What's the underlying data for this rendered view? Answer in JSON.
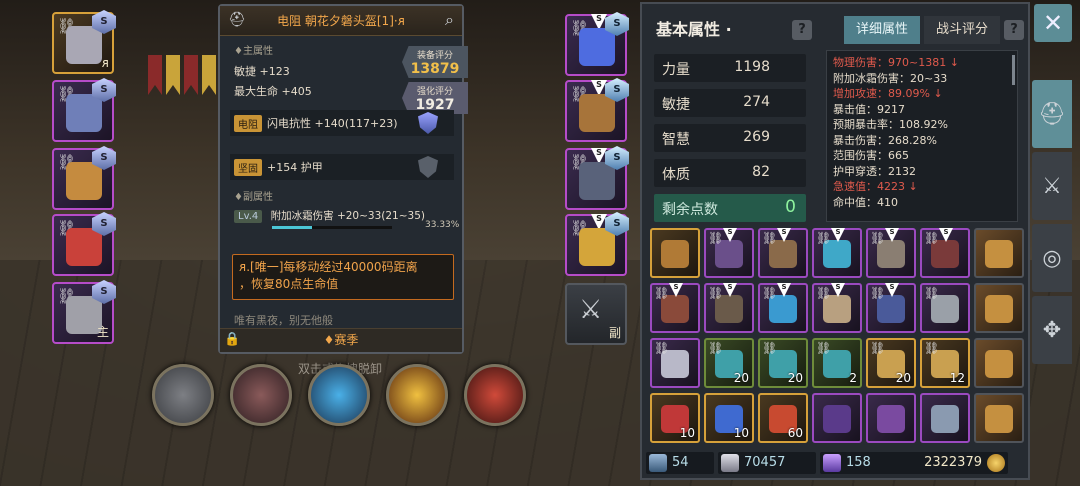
{
  "tooltip": {
    "item_name": "电阻 朝花夕磐头盔[1]·ᴙ",
    "main_section": "♦主属性",
    "main_attrs": [
      "敏捷 +123",
      "最大生命 +405"
    ],
    "equip_score_label": "装备评分",
    "equip_score": "13879",
    "enhance_score_label": "强化评分",
    "enhance_score": "1927",
    "resist_tag": "电阻",
    "resist_text": "闪电抗性 +140(117+23)",
    "sturdy_tag": "坚固",
    "sturdy_text": "+154 护甲",
    "sub_section": "♦副属性",
    "sub_level": "Lv.4",
    "sub_attr": "附加冰霜伤害 +20~33(21~35)",
    "sub_progress": "33.33%",
    "unique_text_1": "ᴙ.[唯一]每移动经过40000码距离",
    "unique_text_2": "，恢复80点生命值",
    "flavor": "唯有黑夜，别无他般",
    "season": "♦赛季"
  },
  "hint_text": "双击或拖拽脱卸",
  "left_slots": [
    {
      "name": "helmet",
      "tag": "ᴙ",
      "art": "#a9a7b4"
    },
    {
      "name": "chest",
      "tag": "",
      "art": "#6f7fb8"
    },
    {
      "name": "gloves",
      "tag": "",
      "art": "#c58b3f"
    },
    {
      "name": "amulet",
      "tag": "",
      "art": "#c9413a"
    },
    {
      "name": "weapon",
      "tag": "主",
      "art": "#a0a0a8"
    }
  ],
  "right_slots": [
    {
      "name": "bracer",
      "tag": "",
      "art": "#4e6ce0"
    },
    {
      "name": "belt",
      "tag": "",
      "art": "#a7743a"
    },
    {
      "name": "boots",
      "tag": "",
      "art": "#59627a"
    },
    {
      "name": "ring",
      "tag": "",
      "art": "#d4a53a"
    }
  ],
  "offhand_label": "副",
  "panel": {
    "title": "基本属性 ·",
    "help": "?",
    "tab_detail": "详细属性",
    "tab_battle": "战斗评分",
    "attributes": [
      {
        "name": "力量",
        "value": "1198"
      },
      {
        "name": "敏捷",
        "value": "274"
      },
      {
        "name": "智慧",
        "value": "269"
      },
      {
        "name": "体质",
        "value": "82"
      }
    ],
    "remaining_label": "剩余点数",
    "remaining_value": "0",
    "details": [
      {
        "text": "物理伤害：970~1381 ↓",
        "red": true
      },
      {
        "text": "附加冰霜伤害：20~33",
        "red": false
      },
      {
        "text": "增加攻速：89.09% ↓",
        "red": true
      },
      {
        "text": "暴击值：9217",
        "red": false
      },
      {
        "text": "预期暴击率：108.92%",
        "red": false
      },
      {
        "text": "暴击伤害：268.28%",
        "red": false
      },
      {
        "text": "范围伤害：665",
        "red": false
      },
      {
        "text": "护甲穿透：2132",
        "red": false
      },
      {
        "text": "急速值：4223 ↓",
        "red": true
      },
      {
        "text": "命中值：410",
        "red": false
      }
    ]
  },
  "inventory": [
    {
      "cls": "",
      "art": "#b07a36",
      "s": false,
      "chain": false,
      "count": ""
    },
    {
      "cls": "pur",
      "art": "#6a4f8a",
      "s": true,
      "chain": true,
      "count": ""
    },
    {
      "cls": "pur",
      "art": "#8a6a4a",
      "s": true,
      "chain": true,
      "count": ""
    },
    {
      "cls": "pur",
      "art": "#3fa8c8",
      "s": true,
      "chain": true,
      "count": ""
    },
    {
      "cls": "pur",
      "art": "#8a7e72",
      "s": true,
      "chain": true,
      "count": ""
    },
    {
      "cls": "pur",
      "art": "#7a3a3a",
      "s": true,
      "chain": true,
      "count": ""
    },
    {
      "cls": "bag",
      "art": "#c59040",
      "s": false,
      "chain": false,
      "count": ""
    },
    {
      "cls": "pur",
      "art": "#8a4a3a",
      "s": true,
      "chain": true,
      "count": ""
    },
    {
      "cls": "pur",
      "art": "#6a5a4a",
      "s": true,
      "chain": true,
      "count": ""
    },
    {
      "cls": "pur",
      "art": "#3a9ad0",
      "s": true,
      "chain": true,
      "count": ""
    },
    {
      "cls": "pur",
      "art": "#b8a080",
      "s": true,
      "chain": true,
      "count": ""
    },
    {
      "cls": "pur",
      "art": "#4a5a9a",
      "s": true,
      "chain": true,
      "count": ""
    },
    {
      "cls": "pur",
      "art": "#9aa0a8",
      "s": false,
      "chain": true,
      "count": ""
    },
    {
      "cls": "bag",
      "art": "#c59040",
      "s": false,
      "chain": false,
      "count": ""
    },
    {
      "cls": "pur",
      "art": "#b8b8c8",
      "s": false,
      "chain": true,
      "count": ""
    },
    {
      "cls": "grn",
      "art": "#3fa0a8",
      "s": false,
      "chain": true,
      "count": "20"
    },
    {
      "cls": "grn",
      "art": "#3fa0a8",
      "s": false,
      "chain": true,
      "count": "20"
    },
    {
      "cls": "grn",
      "art": "#3fa0a8",
      "s": false,
      "chain": true,
      "count": "2"
    },
    {
      "cls": "",
      "art": "#c9a050",
      "s": false,
      "chain": true,
      "count": "20"
    },
    {
      "cls": "",
      "art": "#c9a050",
      "s": false,
      "chain": true,
      "count": "12"
    },
    {
      "cls": "bag",
      "art": "#c59040",
      "s": false,
      "chain": false,
      "count": ""
    },
    {
      "cls": "",
      "art": "#c03838",
      "s": false,
      "chain": false,
      "count": "10"
    },
    {
      "cls": "",
      "art": "#3f6ad0",
      "s": false,
      "chain": false,
      "count": "10"
    },
    {
      "cls": "",
      "art": "#c84a30",
      "s": false,
      "chain": false,
      "count": "60"
    },
    {
      "cls": "pur",
      "art": "#5a3a8a",
      "s": false,
      "chain": false,
      "count": ""
    },
    {
      "cls": "pur",
      "art": "#7a4aa0",
      "s": false,
      "chain": false,
      "count": ""
    },
    {
      "cls": "pur",
      "art": "#8a9ab0",
      "s": false,
      "chain": false,
      "count": ""
    },
    {
      "cls": "bag",
      "art": "#c59040",
      "s": false,
      "chain": false,
      "count": ""
    }
  ],
  "resources": {
    "shards": "54",
    "gems": "70457",
    "crystals": "158",
    "gold": "2322379"
  },
  "close": "✕",
  "colors": {
    "accent": "#5f8f98",
    "gold_border": "#d6a13a",
    "purple_border": "#9b4ac0",
    "red_text": "#e05a4c"
  }
}
